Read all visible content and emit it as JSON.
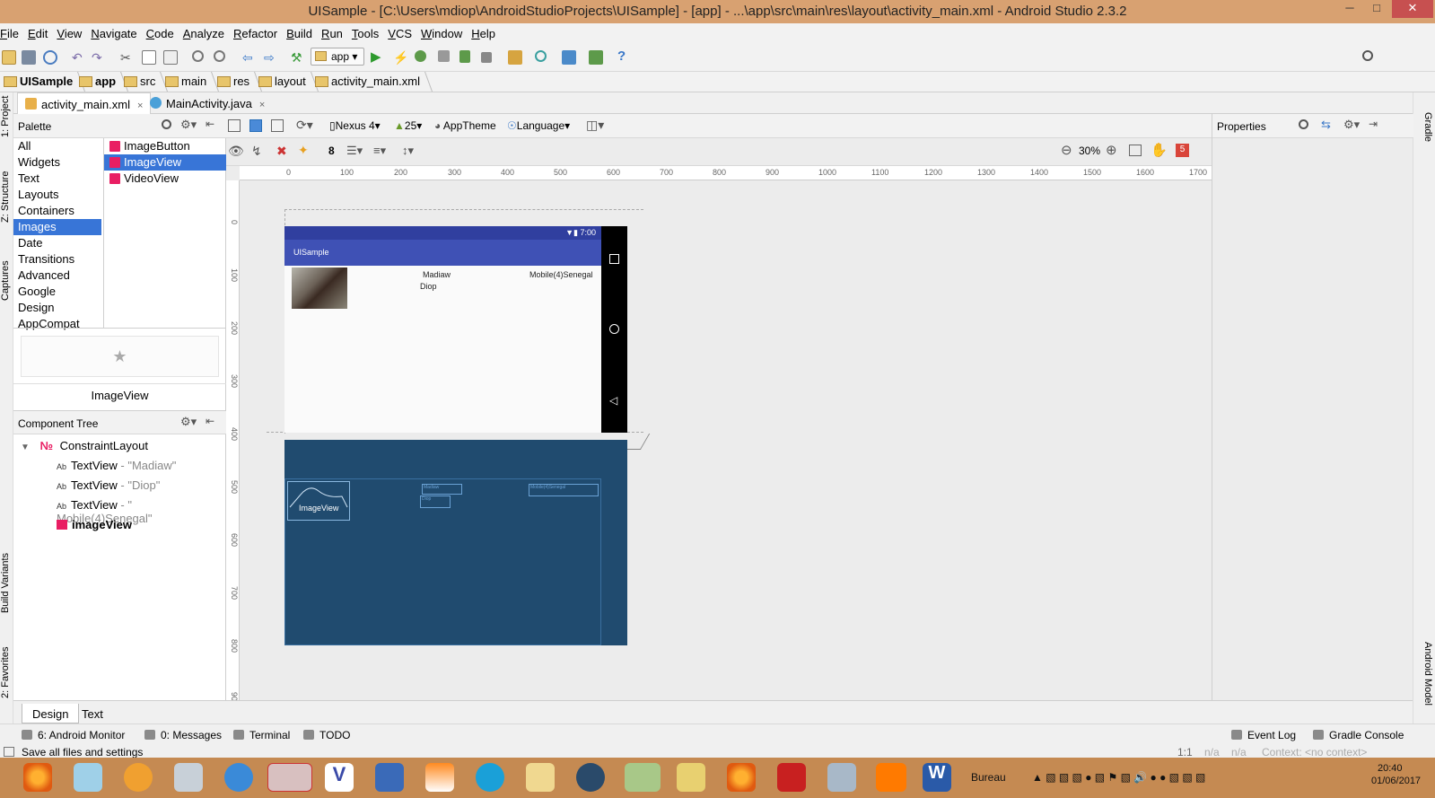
{
  "window": {
    "title": "UISample - [C:\\Users\\mdiop\\AndroidStudioProjects\\UISample] - [app] - ...\\app\\src\\main\\res\\layout\\activity_main.xml - Android Studio 2.3.2",
    "minimize": "─",
    "maximize": "□",
    "close": "✕"
  },
  "menu": [
    "File",
    "Edit",
    "View",
    "Navigate",
    "Code",
    "Analyze",
    "Refactor",
    "Build",
    "Run",
    "Tools",
    "VCS",
    "Window",
    "Help"
  ],
  "toolbar": {
    "run_config": "app",
    "help": "?"
  },
  "breadcrumbs": [
    "UISample",
    "app",
    "src",
    "main",
    "res",
    "layout",
    "activity_main.xml"
  ],
  "left_strip": [
    "1: Project",
    "Z: Structure",
    "Captures",
    "Build Variants",
    "2: Favorites"
  ],
  "right_strip": [
    "Gradle",
    "Android Model"
  ],
  "editor_tabs": [
    {
      "label": "activity_main.xml",
      "close": "×"
    },
    {
      "label": "MainActivity.java",
      "close": "×"
    }
  ],
  "palette": {
    "title": "Palette",
    "categories": [
      "All",
      "Widgets",
      "Text",
      "Layouts",
      "Containers",
      "Images",
      "Date",
      "Transitions",
      "Advanced",
      "Google",
      "Design",
      "AppCompat"
    ],
    "selected_category": "Images",
    "items": [
      "ImageButton",
      "ImageView",
      "VideoView"
    ],
    "selected_item": "ImageView",
    "preview_label": "ImageView"
  },
  "component_tree": {
    "title": "Component Tree",
    "root": "ConstraintLayout",
    "children": [
      {
        "type": "TextView",
        "hint": " - \"Madiaw\""
      },
      {
        "type": "TextView",
        "hint": " - \"Diop\""
      },
      {
        "type": "TextView",
        "hint": " - \" Mobile(4)Senegal\""
      },
      {
        "type": "imageView",
        "hint": ""
      }
    ]
  },
  "design_toolbar": {
    "device": "Nexus 4",
    "api": "25",
    "theme": "AppTheme",
    "language": "Language",
    "margin": "8",
    "zoom": "30%",
    "warnings": "5"
  },
  "ruler_h": [
    "0",
    "100",
    "200",
    "300",
    "400",
    "500",
    "600",
    "700",
    "800",
    "900",
    "1000",
    "1100",
    "1200",
    "1300",
    "1400",
    "1500",
    "1600",
    "1700"
  ],
  "ruler_v": [
    "0",
    "100",
    "200",
    "300",
    "400",
    "500",
    "600",
    "700",
    "800",
    "900"
  ],
  "phone": {
    "time": "7:00",
    "app_title": "UISample",
    "text_first": "Madiaw",
    "text_last": "Diop",
    "text_mobile": "Mobile(4)Senegal"
  },
  "blueprint": {
    "imageview_label": "ImageView",
    "text_first": "Madiaw",
    "text_last": "Diop",
    "text_mobile": "Mobile(4)Senegal"
  },
  "properties": {
    "title": "Properties"
  },
  "bottom_tabs": [
    "Design",
    "Text"
  ],
  "tool_windows": {
    "android_monitor": "6: Android Monitor",
    "messages": "0: Messages",
    "terminal": "Terminal",
    "todo": "TODO",
    "event_log": "Event Log",
    "gradle_console": "Gradle Console"
  },
  "status": {
    "message": "Save all files and settings",
    "position": "1:1",
    "na1": "n/a",
    "na2": "n/a",
    "context": "Context: <no context>"
  },
  "taskbar": {
    "bureau": "Bureau",
    "time": "20:40",
    "date": "01/06/2017"
  }
}
